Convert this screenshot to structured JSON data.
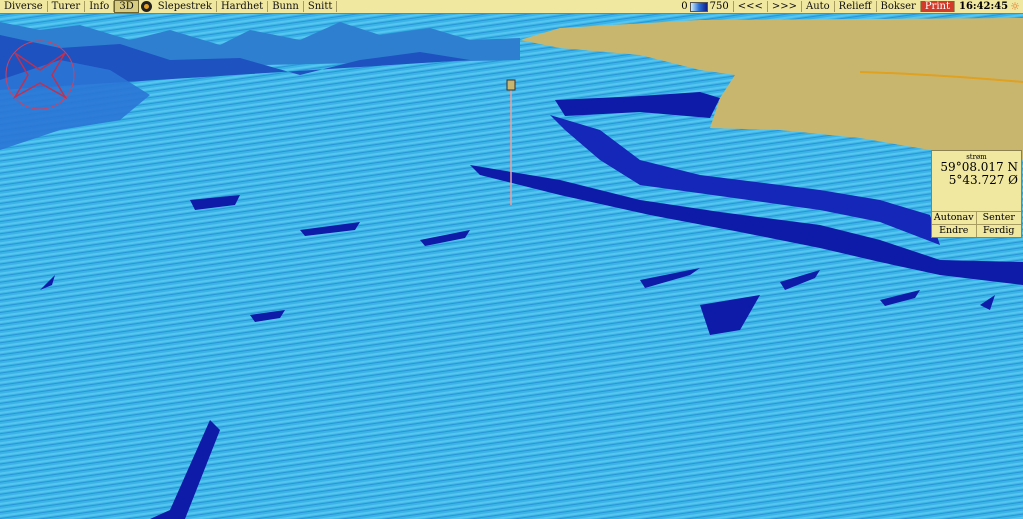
{
  "toolbar": {
    "left_items": [
      "Diverse",
      "Turer",
      "Info",
      "3D"
    ],
    "right_left_items": [
      "Slepestrek",
      "Hardhet",
      "Bunn",
      "Snitt"
    ],
    "legend_min": "0",
    "legend_max": "750",
    "nav_items": [
      "<<<",
      ">>>",
      "Auto",
      "Relieff",
      "Bokser",
      "Print"
    ],
    "time": "16:42:45"
  },
  "info_panel": {
    "label": "strøm",
    "lat": "59°08.017 N",
    "lon": "5°43.727 Ø",
    "buttons": [
      "Autonav",
      "Senter",
      "Endre",
      "Ferdig"
    ]
  },
  "colors": {
    "toolbar_bg": "#f0e7a0",
    "land": "#c9b66e",
    "seabed_light": "#3ab4e6",
    "seabed_dark": "#0e1aa8",
    "print_button": "#d23a2a"
  },
  "icons": [
    "target-icon",
    "sun-icon",
    "compass-rose-icon"
  ]
}
